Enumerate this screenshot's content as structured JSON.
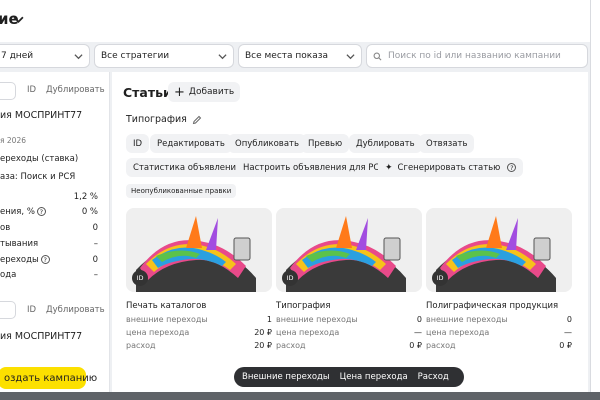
{
  "header": {
    "title": "ие"
  },
  "filters": {
    "period": "7 дней",
    "strategy": "Все стратегии",
    "placement": "Все места показа",
    "search_placeholder": "Поиск по id или названию кампании"
  },
  "sidebar": {
    "top_id": "ID",
    "top_dup": "Дублировать",
    "campaign_name": "ия МОСПРИНТ77",
    "date": "я 2026",
    "strategy": "ереходы (ставка)",
    "places": "аза: Поиск и РСЯ",
    "metrics": [
      {
        "label": "",
        "value": "1,2 %"
      },
      {
        "label": "ения, %",
        "value": "0 %"
      },
      {
        "label": "ов",
        "value": "0"
      },
      {
        "label": "тывания",
        "value": "–"
      },
      {
        "label": "ереходы",
        "value": "0"
      },
      {
        "label": "ода",
        "value": "–"
      }
    ],
    "second_id": "ID",
    "second_dup": "Дублировать",
    "second_name": "ия МОСПРИНТ77",
    "create_button": "оздать кампанию"
  },
  "main": {
    "title": "Статьи",
    "add_button": "Добавить",
    "subtitle": "Типография",
    "actions": [
      "ID",
      "Редактировать",
      "Опубликовать",
      "Превью",
      "Дублировать",
      "Отвязать"
    ],
    "actions2": [
      "Статистика объявлений",
      "Настроить объявления для РСЯ",
      "Сгенерировать статью"
    ],
    "badge": "Неопубликованные правки",
    "cards": [
      {
        "badge": "ID",
        "name": "Печать каталогов",
        "metrics": [
          {
            "label": "внешние переходы",
            "value": "1"
          },
          {
            "label": "цена перехода",
            "value": "20 ₽"
          },
          {
            "label": "расход",
            "value": "20 ₽"
          }
        ]
      },
      {
        "badge": "ID",
        "name": "Типография",
        "metrics": [
          {
            "label": "внешние переходы",
            "value": "0"
          },
          {
            "label": "цена перехода",
            "value": "—"
          },
          {
            "label": "расход",
            "value": "0 ₽"
          }
        ]
      },
      {
        "badge": "ID",
        "name": "Полиграфическая продукция",
        "metrics": [
          {
            "label": "внешние переходы",
            "value": "0"
          },
          {
            "label": "цена перехода",
            "value": "—"
          },
          {
            "label": "расход",
            "value": "0 ₽"
          }
        ]
      }
    ]
  },
  "floating_bar": {
    "items": [
      "Внешние переходы",
      "Цена перехода",
      "Расход"
    ]
  },
  "colors": {
    "accent_yellow": "#fce000",
    "chip_bg": "#f1f2f4",
    "floating_bg": "#2f3033"
  },
  "icons": [
    "chevron-down-icon",
    "search-icon",
    "pencil-icon",
    "plus-icon",
    "sparkle-icon",
    "help-icon",
    "settings-sliders-icon"
  ]
}
